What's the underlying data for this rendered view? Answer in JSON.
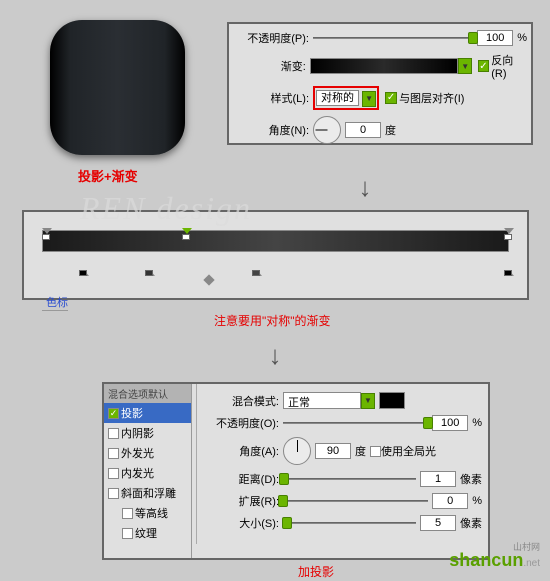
{
  "preview_caption": "投影+渐变",
  "panel1": {
    "opacity_label": "不透明度(P):",
    "opacity_value": "100",
    "percent": "%",
    "gradient_label": "渐变:",
    "reverse_label": "反向(R)",
    "style_label": "样式(L):",
    "style_value": "对称的",
    "align_label": "与图层对齐(I)",
    "angle_label": "角度(N):",
    "angle_value": "0",
    "degree": "度"
  },
  "panel2": {
    "stops_label": "色标",
    "note": "注意要用\"对称\"的渐变"
  },
  "panel3": {
    "header": "混合选项默认",
    "items": [
      {
        "label": "投影",
        "checked": true,
        "active": true
      },
      {
        "label": "内阴影",
        "checked": false
      },
      {
        "label": "外发光",
        "checked": false
      },
      {
        "label": "内发光",
        "checked": false
      },
      {
        "label": "斜面和浮雕",
        "checked": false
      },
      {
        "label": "等高线",
        "checked": false,
        "sub": true
      },
      {
        "label": "纹理",
        "checked": false,
        "sub": true
      }
    ],
    "blend_label": "混合模式:",
    "blend_value": "正常",
    "opacity_label": "不透明度(O):",
    "opacity_value": "100",
    "angle_label": "角度(A):",
    "angle_value": "90",
    "degree": "度",
    "global_light": "使用全局光",
    "distance_label": "距离(D):",
    "distance_value": "1",
    "px": "像素",
    "spread_label": "扩展(R):",
    "spread_value": "0",
    "pct": "%",
    "size_label": "大小(S):",
    "size_value": "5",
    "caption": "加投影"
  },
  "watermark": "REN design",
  "brand": "shancun",
  "brand_net": ".net",
  "brand_cn": "山村网"
}
